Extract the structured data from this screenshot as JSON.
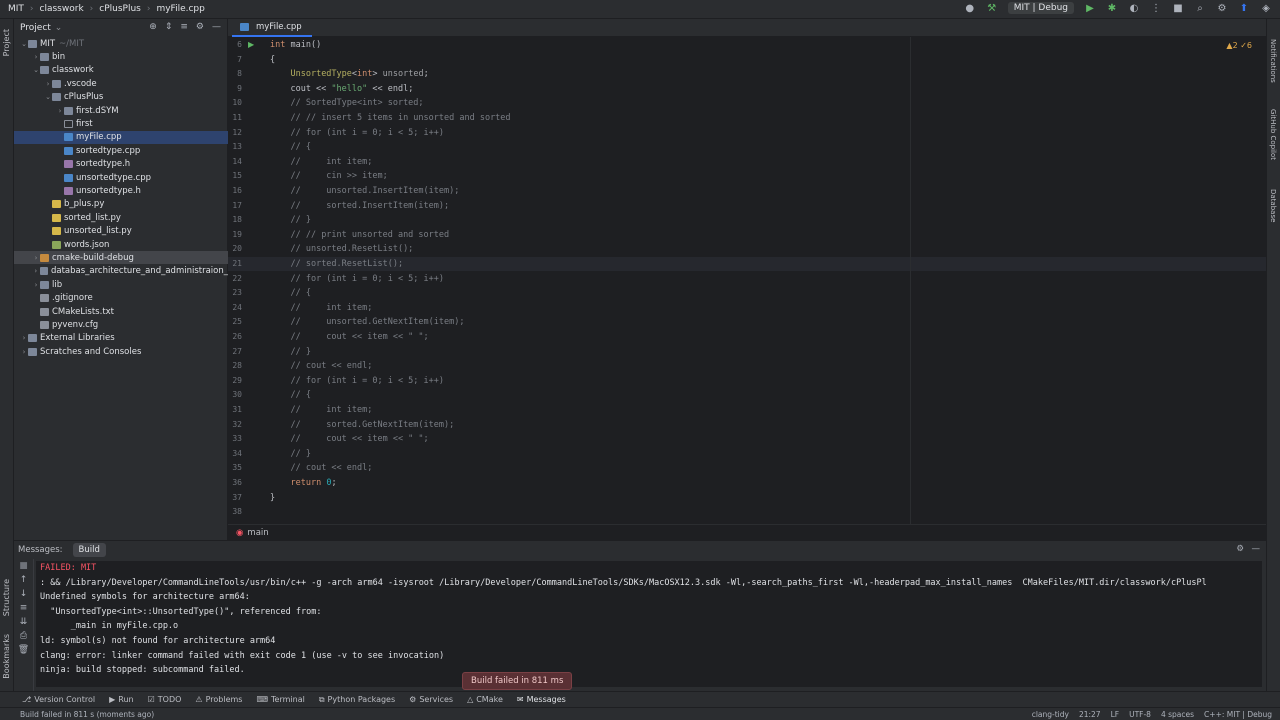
{
  "titlebar": {
    "crumbs": [
      "MIT",
      "classwork",
      "cPlusPlus",
      "myFile.cpp"
    ],
    "run_config": "MIT | Debug"
  },
  "left_strip": {
    "project_label": "Project",
    "structure_label": "Structure",
    "bookmarks_label": "Bookmarks"
  },
  "right_strip": {
    "notifications_label": "Notifications",
    "copilot_label": "GitHub Copilot",
    "database_label": "Database"
  },
  "project_panel": {
    "title": "Project",
    "tree": [
      {
        "label": "MIT",
        "suffix": "~/MIT",
        "depth": 0,
        "kind": "folder",
        "open": true
      },
      {
        "label": "bin",
        "depth": 1,
        "kind": "folder",
        "open": false
      },
      {
        "label": "classwork",
        "depth": 1,
        "kind": "folder",
        "open": true
      },
      {
        "label": ".vscode",
        "depth": 2,
        "kind": "folder",
        "open": false
      },
      {
        "label": "cPlusPlus",
        "depth": 2,
        "kind": "folder",
        "open": true
      },
      {
        "label": "first.dSYM",
        "depth": 3,
        "kind": "folder",
        "open": false
      },
      {
        "label": "first",
        "depth": 3,
        "kind": "plain"
      },
      {
        "label": "myFile.cpp",
        "depth": 3,
        "kind": "cpp",
        "selected": true
      },
      {
        "label": "sortedtype.cpp",
        "depth": 3,
        "kind": "cpp"
      },
      {
        "label": "sortedtype.h",
        "depth": 3,
        "kind": "h"
      },
      {
        "label": "unsortedtype.cpp",
        "depth": 3,
        "kind": "cpp"
      },
      {
        "label": "unsortedtype.h",
        "depth": 3,
        "kind": "h"
      },
      {
        "label": "b_plus.py",
        "depth": 2,
        "kind": "py"
      },
      {
        "label": "sorted_list.py",
        "depth": 2,
        "kind": "py"
      },
      {
        "label": "unsorted_list.py",
        "depth": 2,
        "kind": "py"
      },
      {
        "label": "words.json",
        "depth": 2,
        "kind": "json"
      },
      {
        "label": "cmake-build-debug",
        "depth": 1,
        "kind": "folder-orange",
        "open": false,
        "highlight": true
      },
      {
        "label": "databas_architecture_and_administraion_",
        "depth": 1,
        "kind": "folder",
        "open": false
      },
      {
        "label": "lib",
        "depth": 1,
        "kind": "folder",
        "open": false
      },
      {
        "label": ".gitignore",
        "depth": 1,
        "kind": "txt"
      },
      {
        "label": "CMakeLists.txt",
        "depth": 1,
        "kind": "txt"
      },
      {
        "label": "pyvenv.cfg",
        "depth": 1,
        "kind": "txt"
      },
      {
        "label": "External Libraries",
        "depth": 0,
        "kind": "lib",
        "open": false
      },
      {
        "label": "Scratches and Consoles",
        "depth": 0,
        "kind": "lib",
        "open": false
      }
    ]
  },
  "editor": {
    "tab": "myFile.cpp",
    "inspection": "▲2 ✓6",
    "footer_scope": "main",
    "current_line": 21,
    "lines": [
      {
        "n": 6,
        "segs": [
          [
            "kw",
            "int "
          ],
          [
            "",
            "main()"
          ]
        ]
      },
      {
        "n": 7,
        "segs": [
          [
            "",
            "{"
          ]
        ]
      },
      {
        "n": 8,
        "segs": [
          [
            "",
            "    "
          ],
          [
            "type",
            "UnsortedType"
          ],
          [
            "",
            "<"
          ],
          [
            "kw",
            "int"
          ],
          [
            "",
            "> "
          ],
          [
            "var",
            "unsorted"
          ],
          [
            "",
            ";"
          ]
        ]
      },
      {
        "n": 9,
        "segs": [
          [
            "",
            "    cout << "
          ],
          [
            "str",
            "\"hello\""
          ],
          [
            "",
            " << endl;"
          ]
        ]
      },
      {
        "n": 10,
        "segs": [
          [
            "",
            "    "
          ],
          [
            "comment",
            "// SortedType<int> sorted;"
          ]
        ]
      },
      {
        "n": 11,
        "segs": [
          [
            "",
            "    "
          ],
          [
            "comment",
            "// // insert 5 items in unsorted and sorted"
          ]
        ]
      },
      {
        "n": 12,
        "segs": [
          [
            "",
            "    "
          ],
          [
            "comment",
            "// for (int i = 0; i < 5; i++)"
          ]
        ]
      },
      {
        "n": 13,
        "segs": [
          [
            "",
            "    "
          ],
          [
            "comment",
            "// {"
          ]
        ]
      },
      {
        "n": 14,
        "segs": [
          [
            "",
            "    "
          ],
          [
            "comment",
            "//     int item;"
          ]
        ]
      },
      {
        "n": 15,
        "segs": [
          [
            "",
            "    "
          ],
          [
            "comment",
            "//     cin >> item;"
          ]
        ]
      },
      {
        "n": 16,
        "segs": [
          [
            "",
            "    "
          ],
          [
            "comment",
            "//     unsorted.InsertItem(item);"
          ]
        ]
      },
      {
        "n": 17,
        "segs": [
          [
            "",
            "    "
          ],
          [
            "comment",
            "//     sorted.InsertItem(item);"
          ]
        ]
      },
      {
        "n": 18,
        "segs": [
          [
            "",
            "    "
          ],
          [
            "comment",
            "// }"
          ]
        ]
      },
      {
        "n": 19,
        "segs": [
          [
            "",
            "    "
          ],
          [
            "comment",
            "// // print unsorted and sorted"
          ]
        ]
      },
      {
        "n": 20,
        "segs": [
          [
            "",
            "    "
          ],
          [
            "comment",
            "// unsorted.ResetList();"
          ]
        ]
      },
      {
        "n": 21,
        "segs": [
          [
            "",
            "    "
          ],
          [
            "comment",
            "// sorted.ResetList();"
          ]
        ]
      },
      {
        "n": 22,
        "segs": [
          [
            "",
            "    "
          ],
          [
            "comment",
            "// for (int i = 0; i < 5; i++)"
          ]
        ]
      },
      {
        "n": 23,
        "segs": [
          [
            "",
            "    "
          ],
          [
            "comment",
            "// {"
          ]
        ]
      },
      {
        "n": 24,
        "segs": [
          [
            "",
            "    "
          ],
          [
            "comment",
            "//     int item;"
          ]
        ]
      },
      {
        "n": 25,
        "segs": [
          [
            "",
            "    "
          ],
          [
            "comment",
            "//     unsorted.GetNextItem(item);"
          ]
        ]
      },
      {
        "n": 26,
        "segs": [
          [
            "",
            "    "
          ],
          [
            "comment",
            "//     cout << item << \" \";"
          ]
        ]
      },
      {
        "n": 27,
        "segs": [
          [
            "",
            "    "
          ],
          [
            "comment",
            "// }"
          ]
        ]
      },
      {
        "n": 28,
        "segs": [
          [
            "",
            "    "
          ],
          [
            "comment",
            "// cout << endl;"
          ]
        ]
      },
      {
        "n": 29,
        "segs": [
          [
            "",
            "    "
          ],
          [
            "comment",
            "// for (int i = 0; i < 5; i++)"
          ]
        ]
      },
      {
        "n": 30,
        "segs": [
          [
            "",
            "    "
          ],
          [
            "comment",
            "// {"
          ]
        ]
      },
      {
        "n": 31,
        "segs": [
          [
            "",
            "    "
          ],
          [
            "comment",
            "//     int item;"
          ]
        ]
      },
      {
        "n": 32,
        "segs": [
          [
            "",
            "    "
          ],
          [
            "comment",
            "//     sorted.GetNextItem(item);"
          ]
        ]
      },
      {
        "n": 33,
        "segs": [
          [
            "",
            "    "
          ],
          [
            "comment",
            "//     cout << item << \" \";"
          ]
        ]
      },
      {
        "n": 34,
        "segs": [
          [
            "",
            "    "
          ],
          [
            "comment",
            "// }"
          ]
        ]
      },
      {
        "n": 35,
        "segs": [
          [
            "",
            "    "
          ],
          [
            "comment",
            "// cout << endl;"
          ]
        ]
      },
      {
        "n": 36,
        "segs": [
          [
            "",
            "    "
          ],
          [
            "kw",
            "return "
          ],
          [
            "num",
            "0"
          ],
          [
            "",
            ";"
          ]
        ]
      },
      {
        "n": 37,
        "segs": [
          [
            "",
            "}"
          ]
        ]
      },
      {
        "n": 38,
        "segs": [
          [
            "",
            ""
          ]
        ]
      }
    ]
  },
  "build_panel": {
    "messages_label": "Messages:",
    "build_tab": "Build",
    "output": [
      {
        "text": "FAILED: MIT",
        "err": true
      },
      {
        "text": ": && /Library/Developer/CommandLineTools/usr/bin/c++ -g -arch arm64 -isysroot /Library/Developer/CommandLineTools/SDKs/MacOSX12.3.sdk -Wl,-search_paths_first -Wl,-headerpad_max_install_names  CMakeFiles/MIT.dir/classwork/cPlusPl",
        "err": false
      },
      {
        "text": "Undefined symbols for architecture arm64:",
        "err": false
      },
      {
        "text": "  \"UnsortedType<int>::UnsortedType()\", referenced from:",
        "err": false
      },
      {
        "text": "      _main in myFile.cpp.o",
        "err": false
      },
      {
        "text": "ld: symbol(s) not found for architecture arm64",
        "err": false
      },
      {
        "text": "clang: error: linker command failed with exit code 1 (use -v to see invocation)",
        "err": false
      },
      {
        "text": "ninja: build stopped: subcommand failed.",
        "err": false
      }
    ],
    "toast": "Build failed in 811 ms"
  },
  "bottom_tools": [
    "Version Control",
    "Run",
    "TODO",
    "Problems",
    "Terminal",
    "Python Packages",
    "Services",
    "CMake",
    "Messages"
  ],
  "active_tool": "Messages",
  "statusbar": {
    "left": "Build failed in 811 s (moments ago)",
    "right": [
      "clang-tidy",
      "21:27",
      "LF",
      "UTF-8",
      "4 spaces",
      "C++: MIT | Debug"
    ]
  },
  "colors": {
    "accent": "#3574f0",
    "error": "#f75464",
    "selected": "#2e436e"
  }
}
